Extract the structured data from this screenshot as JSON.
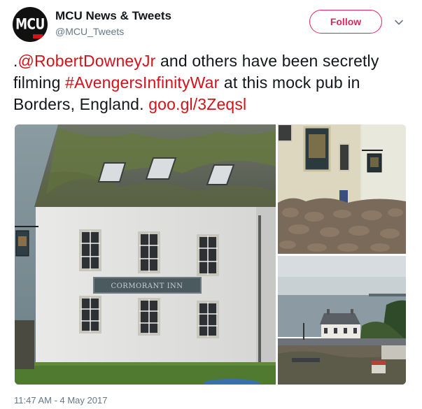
{
  "author": {
    "display_name": "MCU News & Tweets",
    "handle": "@MCU_Tweets",
    "avatar_text": "MCU"
  },
  "actions": {
    "follow_label": "Follow",
    "menu_icon": "chevron-down-icon"
  },
  "tweet": {
    "segments": [
      {
        "text": ".",
        "type": "text"
      },
      {
        "text": "@RobertDowneyJr",
        "type": "link"
      },
      {
        "text": " and others have been secretly filming ",
        "type": "text"
      },
      {
        "text": "#AvengersInfinityWar",
        "type": "link"
      },
      {
        "text": " at this mock pub in Borders, England.  ",
        "type": "text"
      },
      {
        "text": "goo.gl/3Zeqsl",
        "type": "link"
      }
    ],
    "sign_text": "CORMORANT INN",
    "timestamp": "11:47 AM - 4 May 2017"
  },
  "colors": {
    "accent": "#e0245e",
    "link": "#d3121a",
    "secondary_text": "#657786"
  }
}
